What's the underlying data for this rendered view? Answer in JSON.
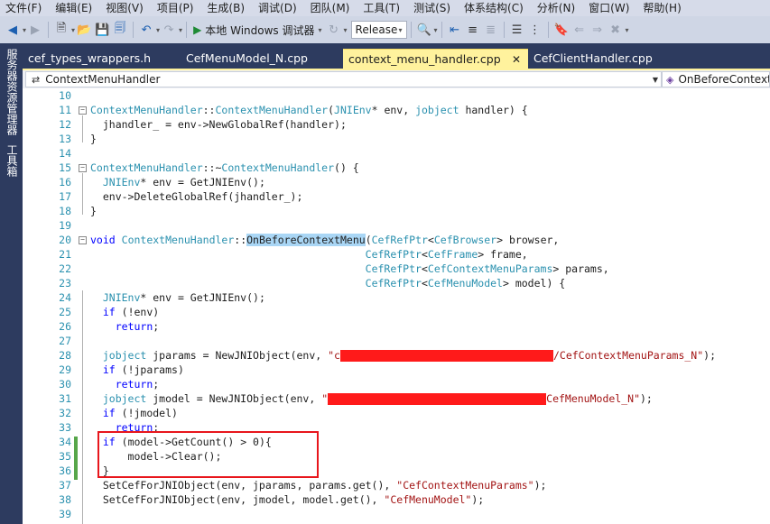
{
  "menu": [
    "文件(F)",
    "编辑(E)",
    "视图(V)",
    "项目(P)",
    "生成(B)",
    "调试(D)",
    "团队(M)",
    "工具(T)",
    "测试(S)",
    "体系结构(C)",
    "分析(N)",
    "窗口(W)",
    "帮助(H)"
  ],
  "toolbar": {
    "run_label": "本地 Windows 调试器",
    "config_value": "Release"
  },
  "side_panels": [
    "服务器资源管理器",
    "工具箱"
  ],
  "tabs": [
    {
      "label": "cef_types_wrappers.h",
      "active": false
    },
    {
      "label": "CefMenuModel_N.cpp",
      "active": false
    },
    {
      "label": "context_menu_handler.cpp",
      "active": true
    },
    {
      "label": "CefClientHandler.cpp",
      "active": false
    }
  ],
  "tab_close_glyph": "✕",
  "nav": {
    "scope": "ContextMenuHandler",
    "member": "OnBeforeContextMenu"
  },
  "highlight_note": "Lines 34-36 outlined with a red rectangle",
  "code_lines": [
    {
      "n": "10",
      "text": ""
    },
    {
      "n": "11",
      "text": "ContextMenuHandler::ContextMenuHandler(JNIEnv* env, jobject handler) {"
    },
    {
      "n": "12",
      "text": "  jhandler_ = env->NewGlobalRef(handler);"
    },
    {
      "n": "13",
      "text": "}"
    },
    {
      "n": "14",
      "text": ""
    },
    {
      "n": "15",
      "text": "ContextMenuHandler::~ContextMenuHandler() {"
    },
    {
      "n": "16",
      "text": "  JNIEnv* env = GetJNIEnv();"
    },
    {
      "n": "17",
      "text": "  env->DeleteGlobalRef(jhandler_);"
    },
    {
      "n": "18",
      "text": "}"
    },
    {
      "n": "19",
      "text": ""
    },
    {
      "n": "20",
      "text": "void ContextMenuHandler::OnBeforeContextMenu(CefRefPtr<CefBrowser> browser,"
    },
    {
      "n": "21",
      "text": "                                            CefRefPtr<CefFrame> frame,"
    },
    {
      "n": "22",
      "text": "                                            CefRefPtr<CefContextMenuParams> params,"
    },
    {
      "n": "23",
      "text": "                                            CefRefPtr<CefMenuModel> model) {"
    },
    {
      "n": "24",
      "text": "  JNIEnv* env = GetJNIEnv();"
    },
    {
      "n": "25",
      "text": "  if (!env)"
    },
    {
      "n": "26",
      "text": "    return;"
    },
    {
      "n": "27",
      "text": ""
    },
    {
      "n": "28",
      "text": "  jobject jparams = NewJNIObject(env, \"c[REDACTED]/CefContextMenuParams_N\");"
    },
    {
      "n": "29",
      "text": "  if (!jparams)"
    },
    {
      "n": "30",
      "text": "    return;"
    },
    {
      "n": "31",
      "text": "  jobject jmodel = NewJNIObject(env, \"[REDACTED]CefMenuModel_N\");"
    },
    {
      "n": "32",
      "text": "  if (!jmodel)"
    },
    {
      "n": "33",
      "text": "    return;"
    },
    {
      "n": "34",
      "text": "  if (model->GetCount() > 0){"
    },
    {
      "n": "35",
      "text": "      model->Clear();"
    },
    {
      "n": "36",
      "text": "  }"
    },
    {
      "n": "37",
      "text": "  SetCefForJNIObject(env, jparams, params.get(), \"CefContextMenuParams\");"
    },
    {
      "n": "38",
      "text": "  SetCefForJNIObject(env, jmodel, model.get(), \"CefMenuModel\");"
    },
    {
      "n": "39",
      "text": ""
    }
  ],
  "colors": {
    "menubar_bg": "#d6dbe9",
    "tab_active_bg": "#fff29d",
    "side_bg": "#2d3b5f",
    "keyword": "#0000ff",
    "type": "#2b91af",
    "string": "#a31515",
    "highlight_box": "#e8161c"
  }
}
